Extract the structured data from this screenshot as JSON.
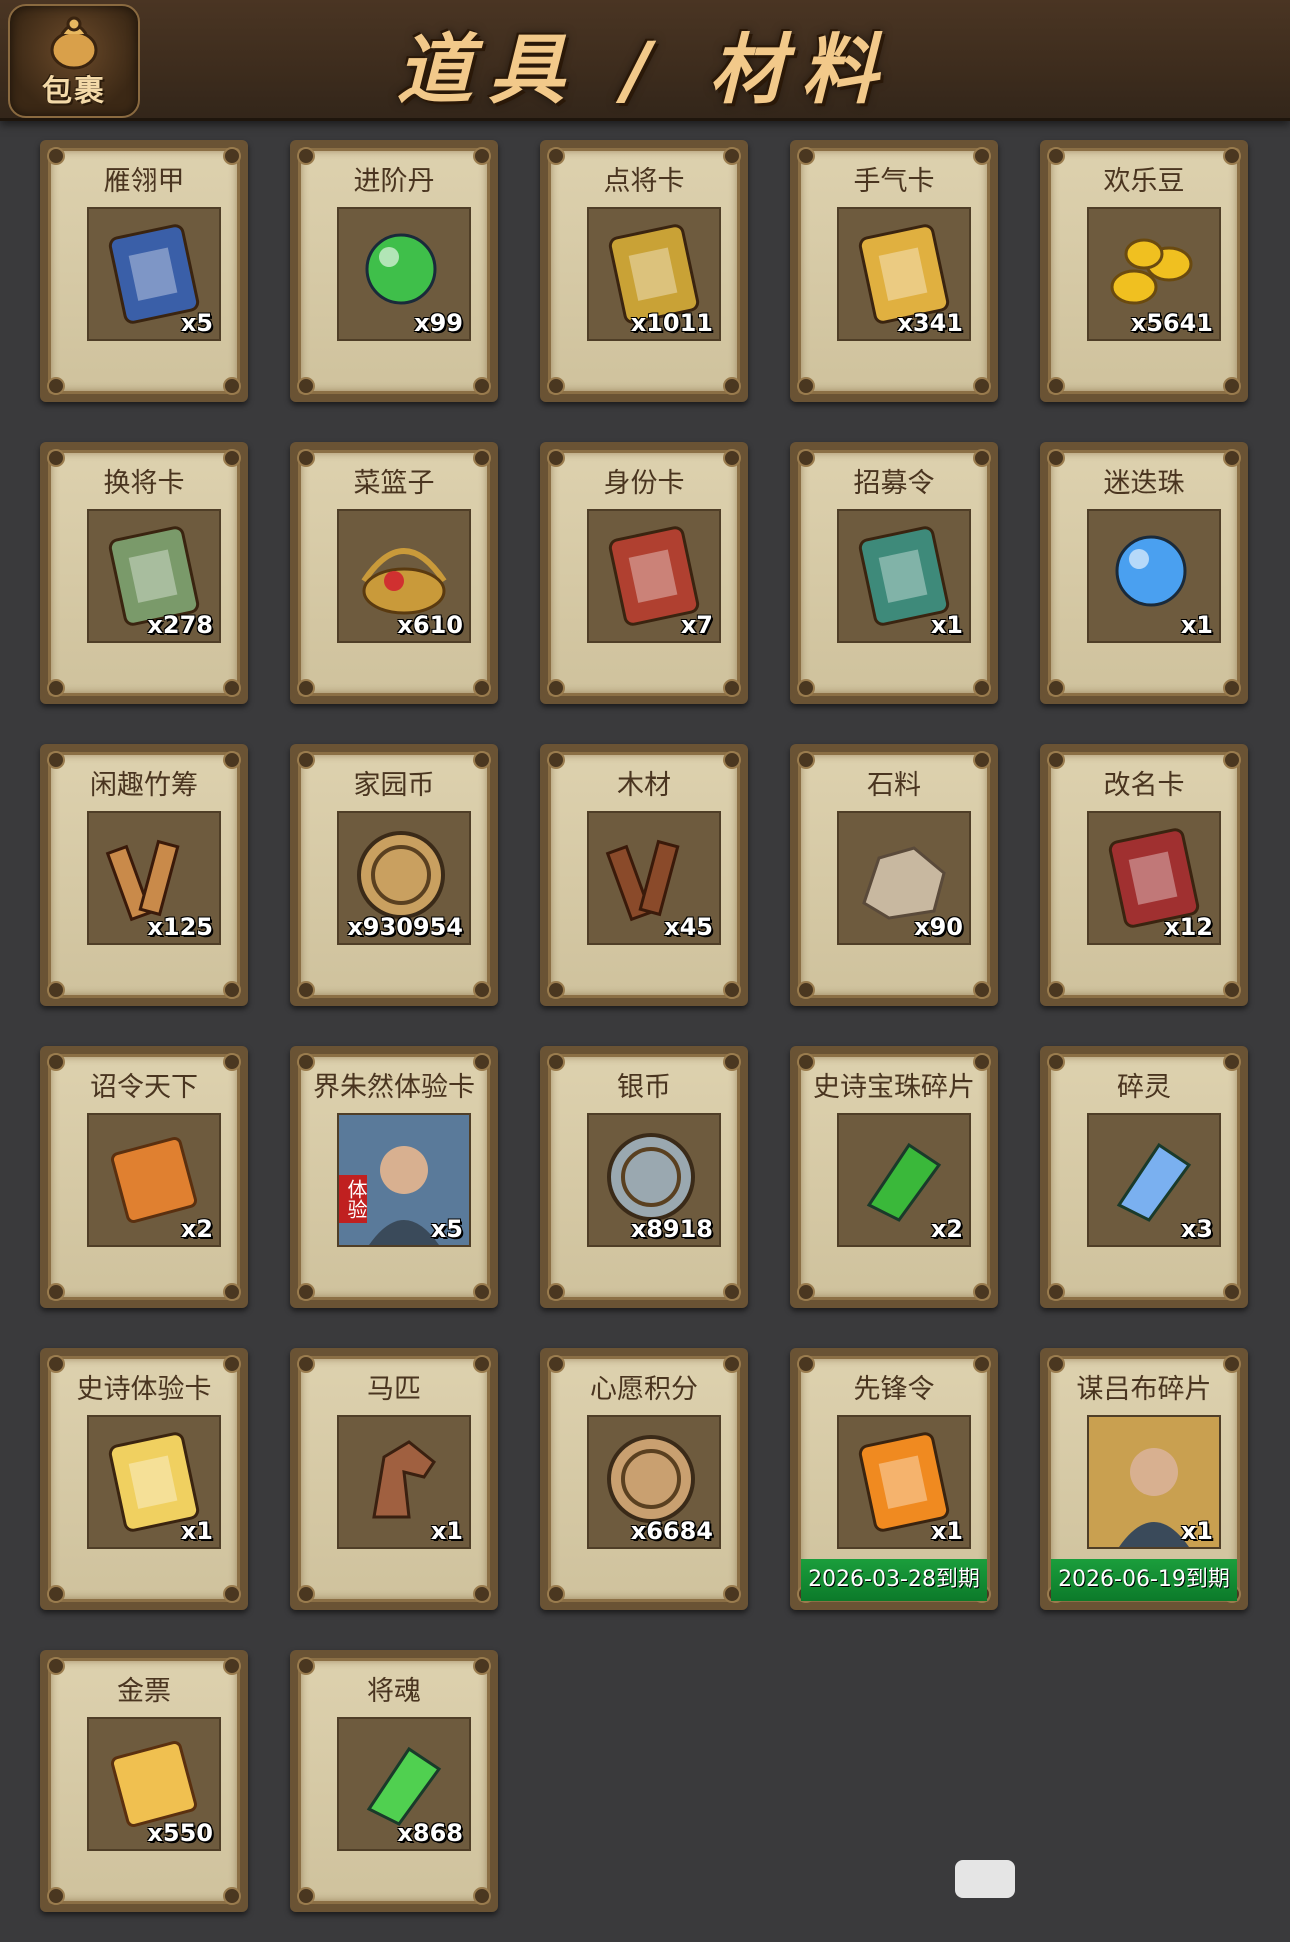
{
  "header": {
    "bag_label": "包裹",
    "title": "道具 / 材料"
  },
  "items": [
    {
      "name": "雁翎甲",
      "count": "x5",
      "icon": "helmet-armor-icon",
      "color": "#3a5fa8"
    },
    {
      "name": "进阶丹",
      "count": "x99",
      "icon": "green-pill-icon",
      "color": "#3fbf4a"
    },
    {
      "name": "点将卡",
      "count": "x1011",
      "icon": "general-card-icon",
      "color": "#c9a236"
    },
    {
      "name": "手气卡",
      "count": "x341",
      "icon": "luck-card-icon",
      "color": "#e0b040"
    },
    {
      "name": "欢乐豆",
      "count": "x5641",
      "icon": "gold-beans-icon",
      "color": "#f0c020"
    },
    {
      "name": "换将卡",
      "count": "x278",
      "icon": "swap-card-icon",
      "color": "#7a9a6a"
    },
    {
      "name": "菜篮子",
      "count": "x610",
      "icon": "basket-icon",
      "color": "#c99a3a"
    },
    {
      "name": "身份卡",
      "count": "x7",
      "icon": "opera-mask-icon",
      "color": "#b04030"
    },
    {
      "name": "招募令",
      "count": "x1",
      "icon": "recruit-token-icon",
      "color": "#3e8a7a"
    },
    {
      "name": "迷迭珠",
      "count": "x1",
      "icon": "blue-orb-icon",
      "color": "#4aa0f0"
    },
    {
      "name": "闲趣竹筹",
      "count": "x125",
      "icon": "bamboo-tally-icon",
      "color": "#c98a4a"
    },
    {
      "name": "家园币",
      "count": "x930954",
      "icon": "home-coin-icon",
      "color": "#c9a060"
    },
    {
      "name": "木材",
      "count": "x45",
      "icon": "wood-icon",
      "color": "#8a4a2a"
    },
    {
      "name": "石料",
      "count": "x90",
      "icon": "stone-icon",
      "color": "#c8b8a0"
    },
    {
      "name": "改名卡",
      "count": "x12",
      "icon": "rename-card-icon",
      "color": "#a03030"
    },
    {
      "name": "诏令天下",
      "count": "x2",
      "icon": "edict-scroll-icon",
      "color": "#e08030"
    },
    {
      "name": "界朱然体验卡",
      "count": "x5",
      "icon": "hero-portrait-icon",
      "color": "#5a7a9a",
      "badge": "体验"
    },
    {
      "name": "银币",
      "count": "x8918",
      "icon": "silver-coin-icon",
      "color": "#9aa8b0"
    },
    {
      "name": "史诗宝珠碎片",
      "count": "x2",
      "icon": "green-shard-icon",
      "color": "#3ab83a"
    },
    {
      "name": "碎灵",
      "count": "x3",
      "icon": "crystal-icon",
      "color": "#7ab0f0"
    },
    {
      "name": "史诗体验卡",
      "count": "x1",
      "icon": "gold-card-icon",
      "color": "#f0d060"
    },
    {
      "name": "马匹",
      "count": "x1",
      "icon": "horse-icon",
      "color": "#a06040"
    },
    {
      "name": "心愿积分",
      "count": "x6684",
      "icon": "heart-coin-icon",
      "color": "#c9a070"
    },
    {
      "name": "先锋令",
      "count": "x1",
      "icon": "vanguard-token-icon",
      "color": "#f08a20",
      "expiry": "2026-03-28到期"
    },
    {
      "name": "谋吕布碎片",
      "count": "x1",
      "icon": "puzzle-portrait-icon",
      "color": "#c9a050",
      "expiry": "2026-06-19到期"
    },
    {
      "name": "金票",
      "count": "x550",
      "icon": "gold-ticket-icon",
      "color": "#f0c050"
    },
    {
      "name": "将魂",
      "count": "x868",
      "icon": "soul-crystal-icon",
      "color": "#50d050"
    }
  ]
}
